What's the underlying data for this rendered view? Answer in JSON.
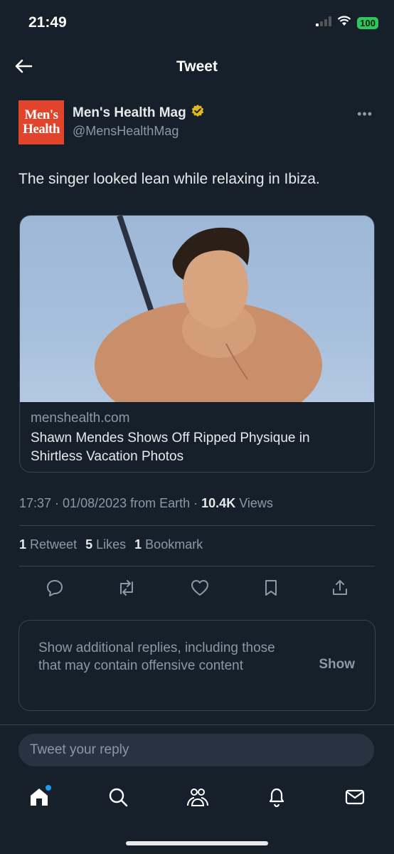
{
  "status_bar": {
    "time": "21:49",
    "battery": "100"
  },
  "header": {
    "title": "Tweet"
  },
  "author": {
    "avatar_line1": "Men's",
    "avatar_line2": "Health",
    "name": "Men's Health Mag",
    "handle": "@MensHealthMag",
    "verified_color": "#e2b719"
  },
  "tweet": {
    "text": "The singer looked lean while relaxing in Ibiza."
  },
  "card": {
    "domain": "menshealth.com",
    "title": "Shawn Mendes Shows Off Ripped Physique in Shirtless Vacation Photos"
  },
  "meta": {
    "time_date": "17:37 · 01/08/2023 from Earth · ",
    "views_count": "10.4K",
    "views_label": " Views"
  },
  "stats": {
    "retweets_count": "1",
    "retweets_label": "Retweet",
    "likes_count": "5",
    "likes_label": "Likes",
    "bookmarks_count": "1",
    "bookmarks_label": "Bookmark"
  },
  "actions": [
    "reply-icon",
    "retweet-icon",
    "like-icon",
    "bookmark-icon",
    "share-icon"
  ],
  "additional_replies": {
    "text": "Show additional replies, including those that may contain offensive content",
    "button": "Show"
  },
  "reply": {
    "placeholder": "Tweet your reply"
  },
  "tabbar": [
    "home-icon",
    "search-icon",
    "communities-icon",
    "notifications-icon",
    "messages-icon"
  ],
  "colors": {
    "background": "#15202b",
    "accent": "#1d9bf0",
    "brand": "#e2432b"
  }
}
